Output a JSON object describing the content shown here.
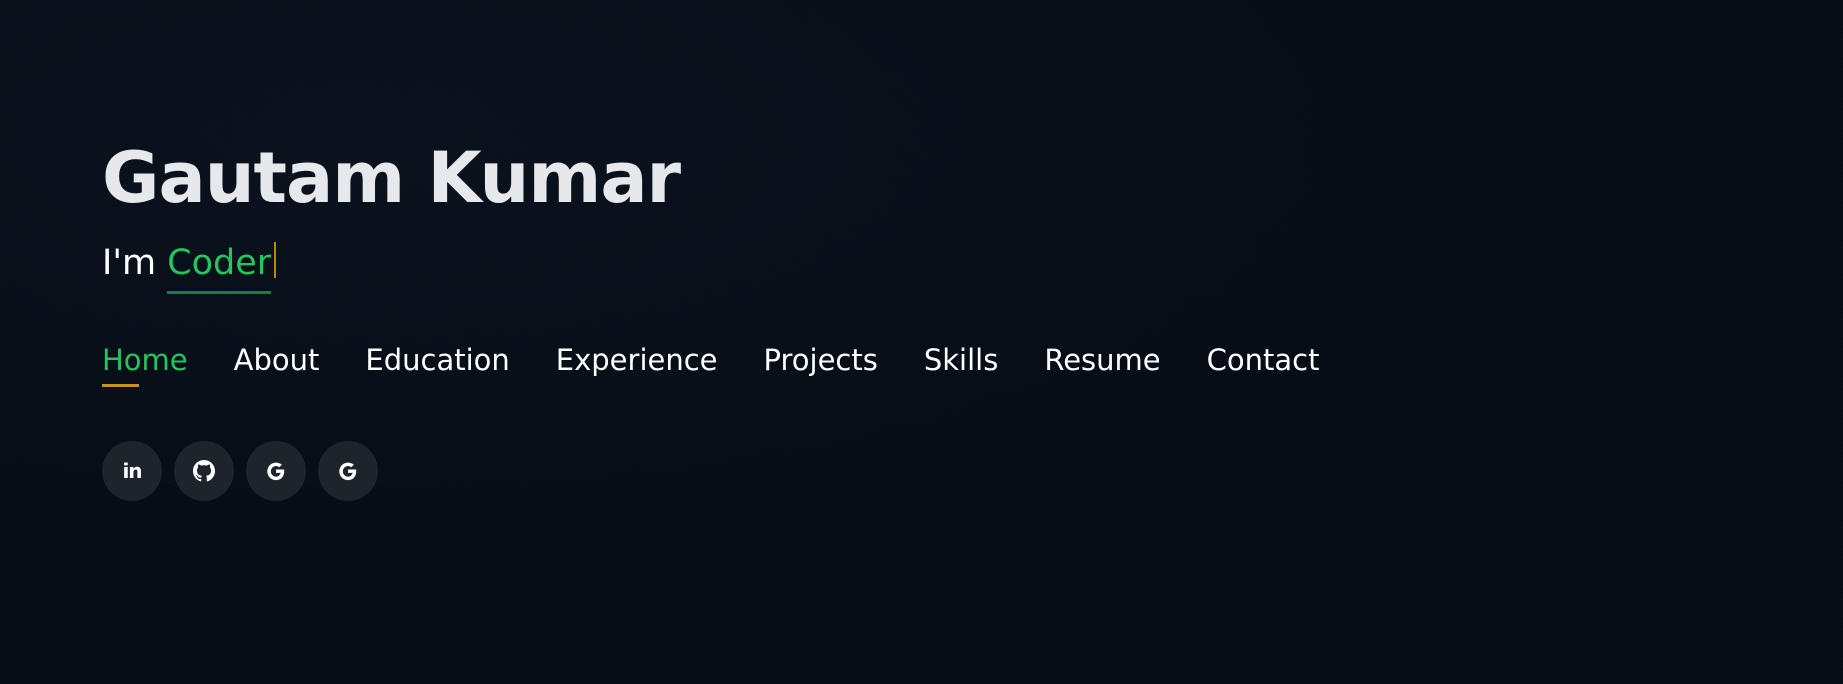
{
  "hero": {
    "name": "Gautam Kumar",
    "tagline_prefix": "I'm ",
    "typed_word": "Coder"
  },
  "nav": {
    "items": [
      {
        "label": "Home",
        "active": true
      },
      {
        "label": "About"
      },
      {
        "label": "Education"
      },
      {
        "label": "Experience"
      },
      {
        "label": "Projects"
      },
      {
        "label": "Skills"
      },
      {
        "label": "Resume"
      },
      {
        "label": "Contact"
      }
    ]
  },
  "social": {
    "links": [
      {
        "icon": "linkedin-icon",
        "glyph": "in"
      },
      {
        "icon": "github-icon"
      },
      {
        "icon": "google-icon"
      },
      {
        "icon": "google-icon"
      }
    ]
  },
  "colors": {
    "background": "#040b14",
    "accent": "#22c55e",
    "underline": "#c4951e",
    "social_bg": "#1e242c"
  }
}
